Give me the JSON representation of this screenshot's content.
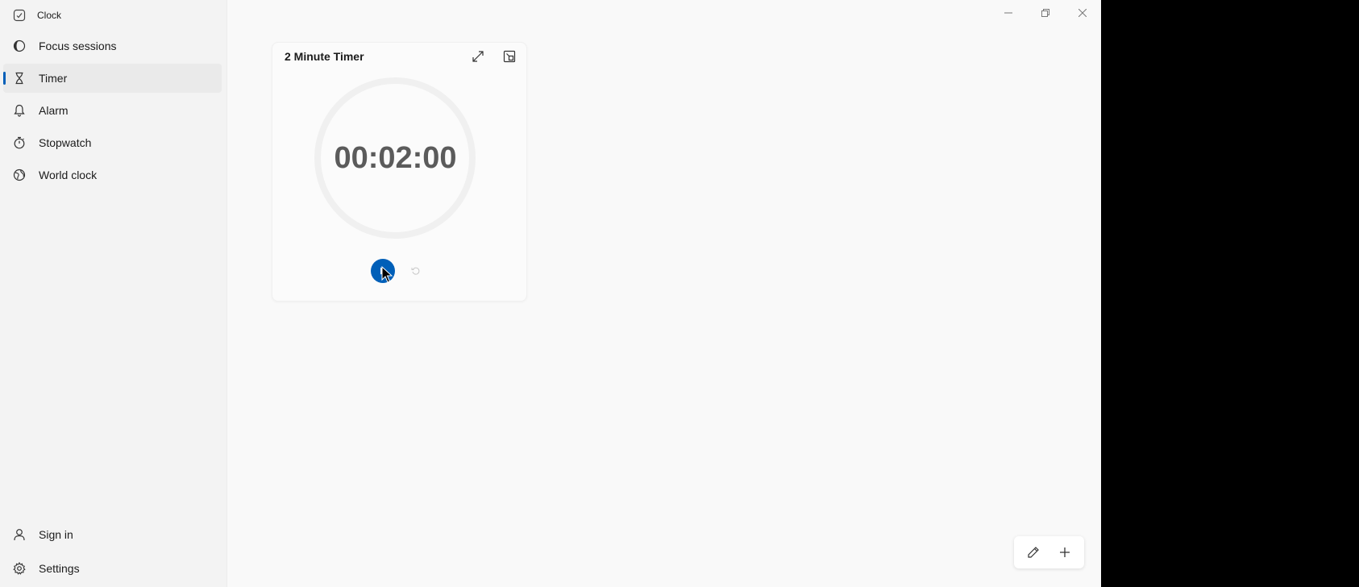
{
  "app": {
    "title": "Clock"
  },
  "sidebar": {
    "items": [
      {
        "label": "Focus sessions",
        "icon": "focus-icon"
      },
      {
        "label": "Timer",
        "icon": "hourglass-icon",
        "active": true
      },
      {
        "label": "Alarm",
        "icon": "bell-icon"
      },
      {
        "label": "Stopwatch",
        "icon": "stopwatch-icon"
      },
      {
        "label": "World clock",
        "icon": "globe-icon"
      }
    ],
    "footer": [
      {
        "label": "Sign in",
        "icon": "person-icon"
      },
      {
        "label": "Settings",
        "icon": "gear-icon"
      }
    ]
  },
  "window_controls": {
    "minimize": "minimize-icon",
    "restore": "restore-icon",
    "close": "close-icon"
  },
  "timer": {
    "title": "2 Minute Timer",
    "time": "00:02:00",
    "expand_icon": "expand-icon",
    "keep_on_top_icon": "keep-on-top-icon",
    "play_icon": "play-icon",
    "reset_icon": "reset-icon"
  },
  "toolbar": {
    "edit_icon": "pencil-icon",
    "add_icon": "plus-icon"
  },
  "colors": {
    "accent": "#005fb8",
    "background": "#f9f9f9",
    "sidebar": "#f3f3f3",
    "text": "#1b1b1b",
    "time_text": "#5b5b5b"
  }
}
